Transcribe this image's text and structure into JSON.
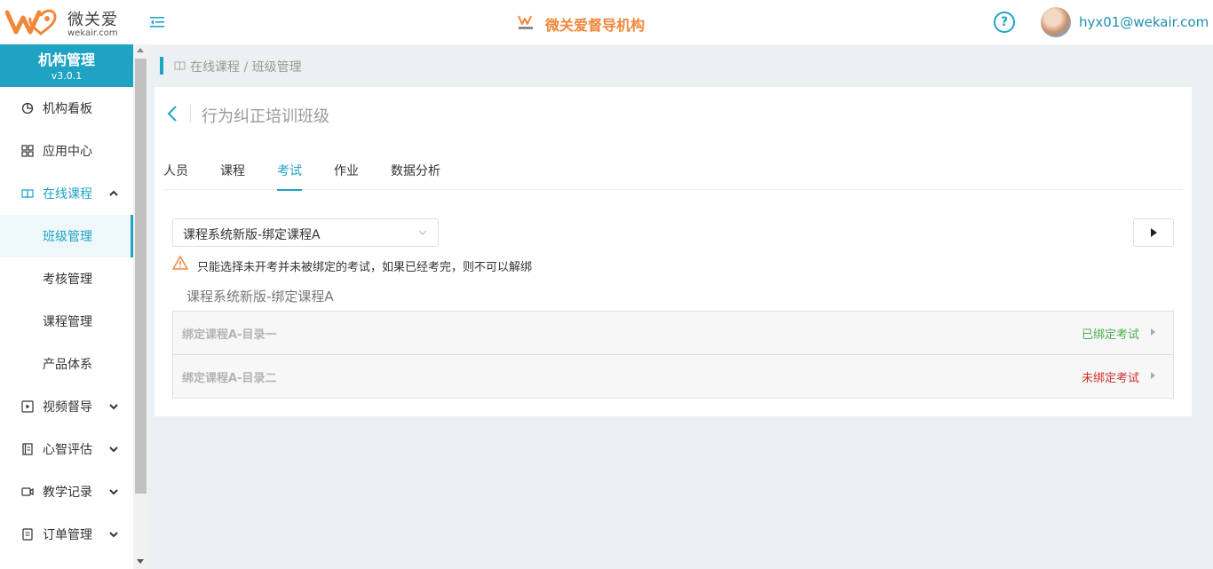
{
  "header": {
    "logo_name": "微关爱",
    "logo_url": "wekair.com",
    "brand_title": "微关爱督导机构",
    "brand_mark_text": "微关爱",
    "help_label": "?",
    "user_name": "hyx01@wekair.com"
  },
  "sidebar": {
    "title": "机构管理",
    "version": "v3.0.1",
    "items": [
      {
        "label": "机构看板",
        "icon": "dashboard-icon"
      },
      {
        "label": "应用中心",
        "icon": "apps-icon"
      },
      {
        "label": "在线课程",
        "icon": "book-icon",
        "expanded": true
      },
      {
        "label": "视频督导",
        "icon": "video-play-icon"
      },
      {
        "label": "心智评估",
        "icon": "notebook-icon"
      },
      {
        "label": "教学记录",
        "icon": "camera-icon"
      },
      {
        "label": "订单管理",
        "icon": "order-icon"
      }
    ],
    "sub_items": [
      {
        "label": "班级管理",
        "selected": true
      },
      {
        "label": "考核管理"
      },
      {
        "label": "课程管理"
      },
      {
        "label": "产品体系"
      }
    ]
  },
  "breadcrumb": {
    "text": "在线课程 / 班级管理"
  },
  "main": {
    "page_title": "行为纠正培训班级",
    "tabs": [
      {
        "label": "人员"
      },
      {
        "label": "课程"
      },
      {
        "label": "考试",
        "active": true
      },
      {
        "label": "作业"
      },
      {
        "label": "数据分析"
      }
    ],
    "select_value": "课程系统新版-绑定课程A",
    "warning": "只能选择未开考并未被绑定的考试，如果已经考完，则不可以解绑",
    "course_name": "课程系统新版-绑定课程A",
    "rows": [
      {
        "label": "绑定课程A-目录一",
        "status": "已绑定考试",
        "status_color": "#4caf50"
      },
      {
        "label": "绑定课程A-目录二",
        "status": "未绑定考试",
        "status_color": "#d32f2f"
      }
    ]
  },
  "colors": {
    "accent": "#1fa3c5",
    "brand": "#f0883a",
    "warning": "#f0883a"
  }
}
